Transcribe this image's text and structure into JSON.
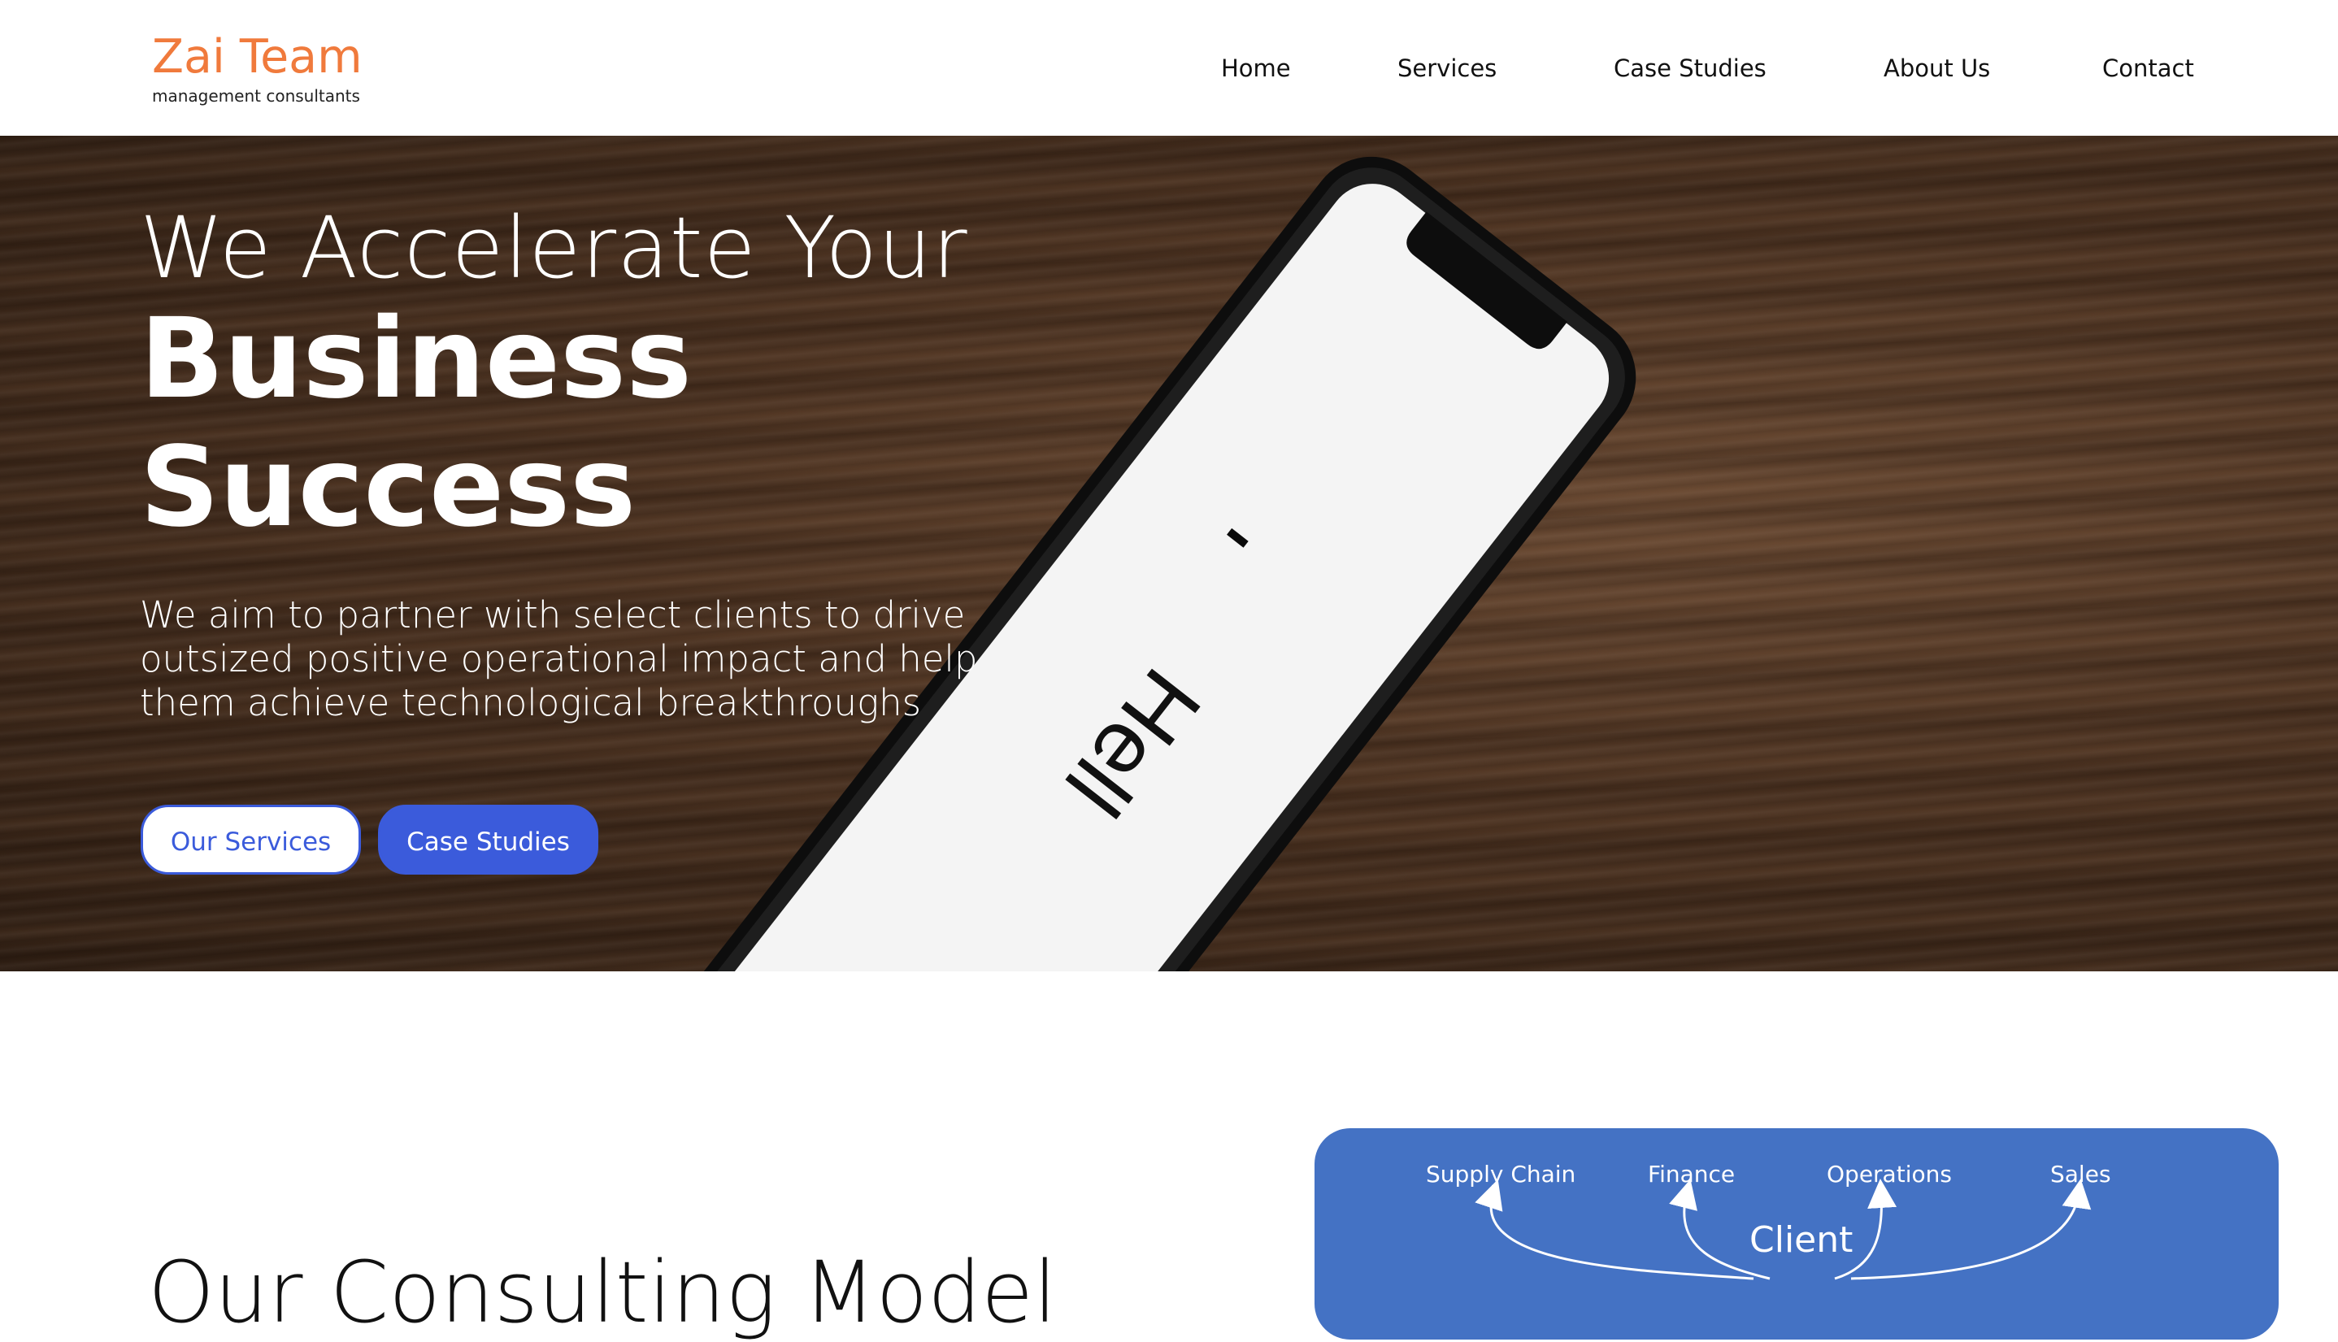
{
  "brand": {
    "name": "Zai Team",
    "tagline": "management consultants",
    "accent_color": "#f07a3c"
  },
  "nav": {
    "items": [
      {
        "label": "Home"
      },
      {
        "label": "Services"
      },
      {
        "label": "Case Studies"
      },
      {
        "label": "About Us"
      },
      {
        "label": "Contact"
      }
    ]
  },
  "hero": {
    "line1": "We Accelerate Your",
    "line2": "Business",
    "line3": "Success",
    "subtitle": "We aim to partner with select clients to drive outsized positive operational impact and help them achieve technological breakthroughs",
    "phone_screen_text": "Hell",
    "buttons": {
      "services_label": "Our Services",
      "case_studies_label": "Case Studies"
    },
    "button_color": "#3b5bdb"
  },
  "model": {
    "title": "Our Consulting Model",
    "diagram": {
      "labels": [
        "Supply Chain",
        "Finance",
        "Operations",
        "Sales"
      ],
      "center": "Client",
      "background_color": "#4472c4"
    }
  }
}
